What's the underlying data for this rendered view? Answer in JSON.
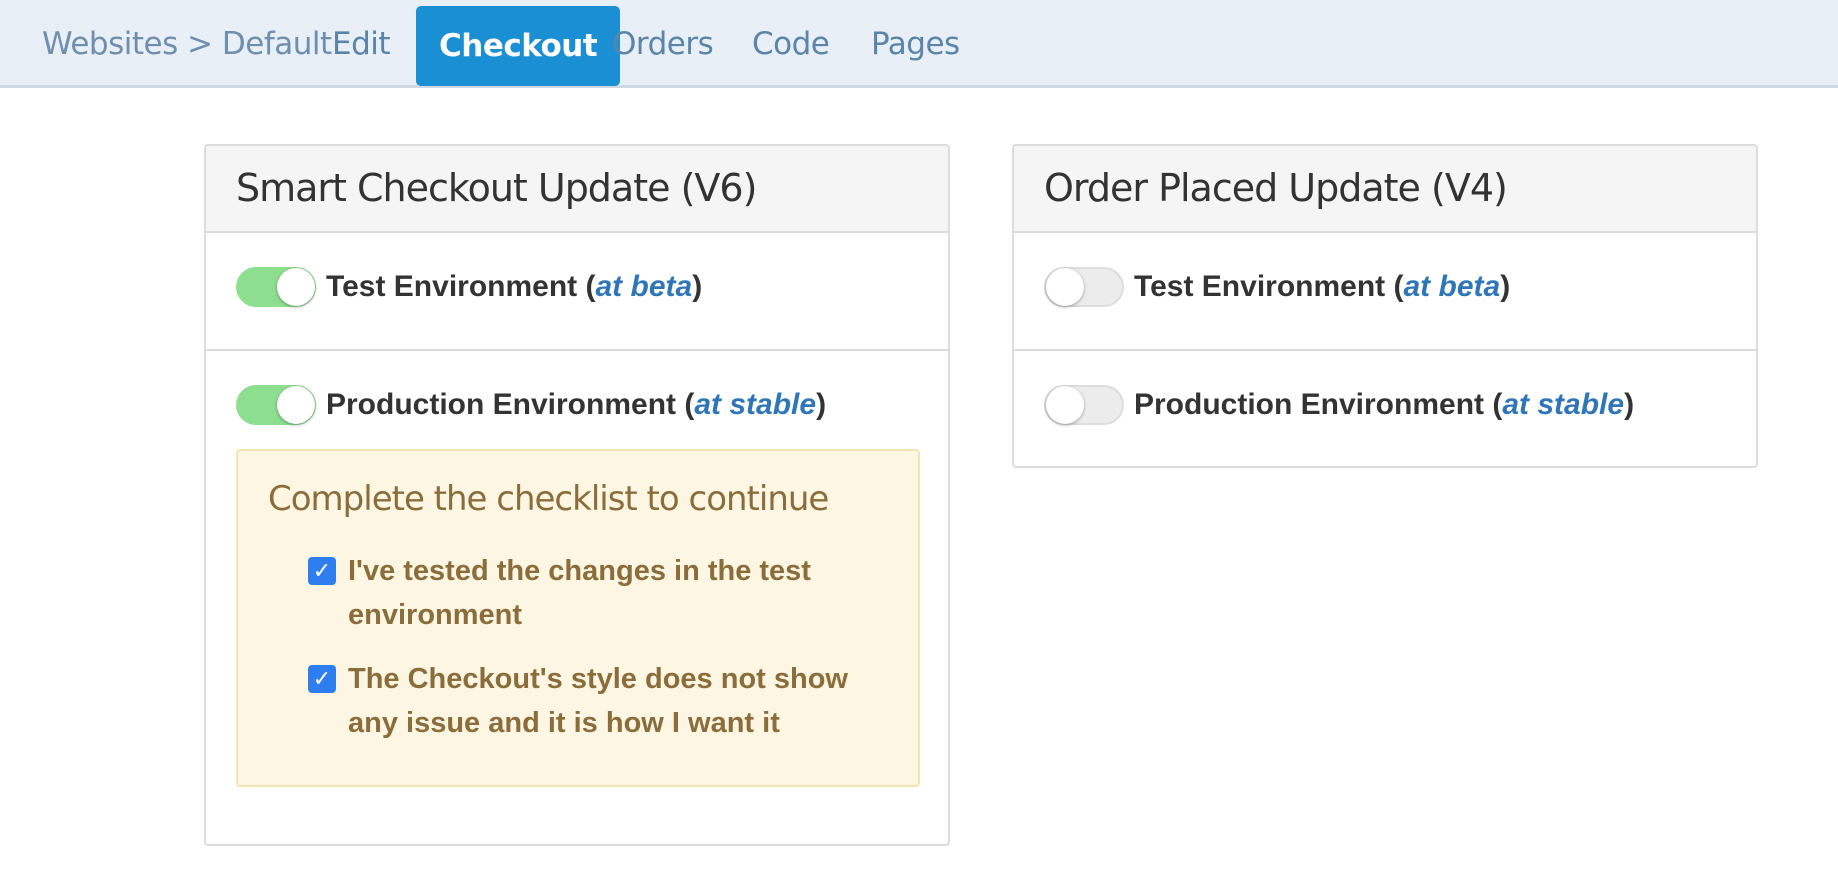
{
  "nav": {
    "breadcrumb": "Websites > Default",
    "links": [
      "Edit",
      "Checkout",
      "Orders",
      "Code",
      "Pages"
    ],
    "active": "Checkout"
  },
  "panels": [
    {
      "title": "Smart Checkout Update (V6)",
      "test": {
        "label": "Test Environment (",
        "version": "at beta",
        "close": ")",
        "enabled": true
      },
      "production": {
        "label": "Production Environment (",
        "version": "at stable",
        "close": ")",
        "enabled": true
      },
      "checklist": {
        "title": "Complete the checklist to continue",
        "items": [
          {
            "text": "I've tested the changes in the test environment",
            "checked": true
          },
          {
            "text": "The Checkout's style does not show any issue and it is how I want it",
            "checked": true
          }
        ]
      }
    },
    {
      "title": "Order Placed Update (V4)",
      "test": {
        "label": "Test Environment (",
        "version": "at beta",
        "close": ")",
        "enabled": false
      },
      "production": {
        "label": "Production Environment (",
        "version": "at stable",
        "close": ")",
        "enabled": false
      }
    }
  ],
  "colors": {
    "nav_bg": "#e8eff6",
    "active_tab": "#1a8fd4",
    "toggle_on": "#8ddf8f",
    "version_link": "#2f76b8",
    "warning_bg": "#fcf6e3",
    "warning_text": "#8a6d3b",
    "checkbox": "#2f7ef0"
  }
}
